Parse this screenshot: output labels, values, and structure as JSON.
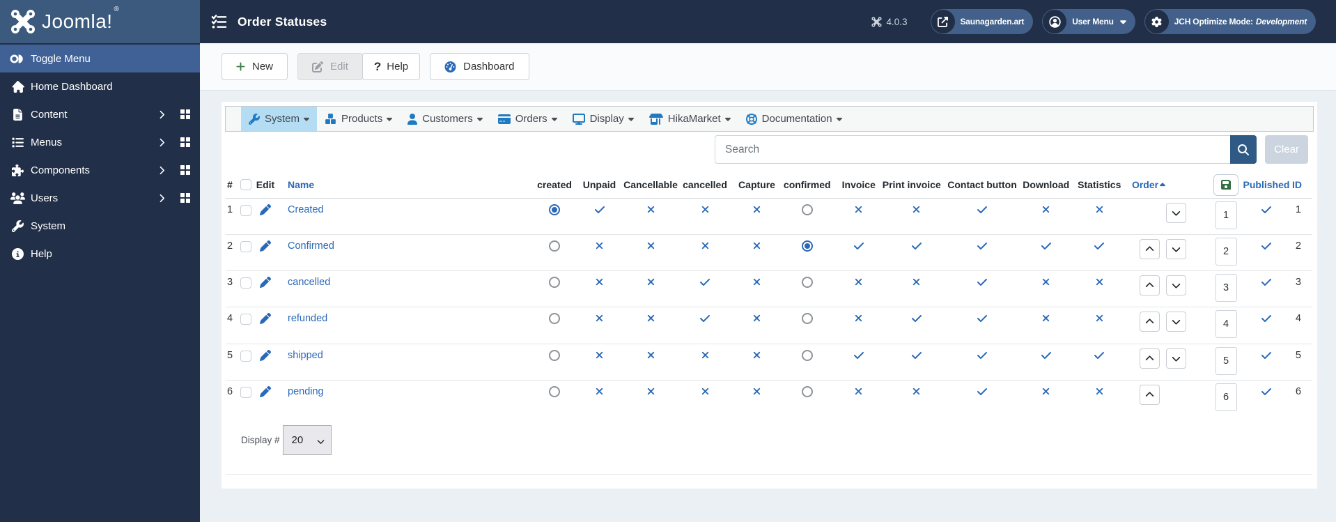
{
  "colors": {
    "topbar_bg": "#212f48",
    "brand_bg": "#3c5a7e",
    "sidebar_bg": "#212f48",
    "sidebar_active_bg": "#3f6195",
    "pill_bg": "#42608a",
    "page_bg": "#e9eef5",
    "link_blue": "#2a69b8",
    "menu_icon_blue": "#1f7ac2",
    "active_menu_bg": "#b4ddf3",
    "green_plus": "#3d7d46",
    "save_green": "#356e41",
    "search_btn_bg": "#2e5a85",
    "clear_btn_bg": "#ccd5df"
  },
  "topbar": {
    "brand_wordmark": "Joomla!",
    "brand_reg": "®",
    "page_title": "Order Statuses",
    "version": "4.0.3",
    "pills": [
      {
        "icon": "external-link-icon",
        "label": "Saunagarden.art",
        "caret": false
      },
      {
        "icon": "user-circle-icon",
        "label": "User Menu",
        "caret": true
      },
      {
        "icon": "gear-icon",
        "label": "JCH Optimize Mode:",
        "label_em": "Development",
        "caret": false
      }
    ]
  },
  "sidebar": {
    "items": [
      {
        "icon": "toggle-icon",
        "label": "Toggle Menu",
        "active": true,
        "chevron": false,
        "grid": false
      },
      {
        "icon": "home-icon",
        "label": "Home Dashboard",
        "active": false,
        "chevron": false,
        "grid": false
      },
      {
        "icon": "file-icon",
        "label": "Content",
        "active": false,
        "chevron": true,
        "grid": true
      },
      {
        "icon": "list-icon",
        "label": "Menus",
        "active": false,
        "chevron": true,
        "grid": true
      },
      {
        "icon": "puzzle-icon",
        "label": "Components",
        "active": false,
        "chevron": true,
        "grid": true
      },
      {
        "icon": "users-icon",
        "label": "Users",
        "active": false,
        "chevron": true,
        "grid": true
      },
      {
        "icon": "wrench-icon",
        "label": "System",
        "active": false,
        "chevron": false,
        "grid": false
      },
      {
        "icon": "info-circle-icon",
        "label": "Help",
        "active": false,
        "chevron": false,
        "grid": false
      }
    ]
  },
  "toolbar": {
    "buttons": [
      {
        "icon": "plus-icon",
        "icon_color": "#3d7d46",
        "label": "New",
        "disabled": false,
        "gap": "first"
      },
      {
        "icon": "edit-square-icon",
        "icon_color": "#9aa0a6",
        "label": "Edit",
        "disabled": true,
        "gap": "m14"
      },
      {
        "icon": "question",
        "icon_color": "#2b2f33",
        "label": "Help",
        "disabled": false,
        "gap": "m0"
      },
      {
        "icon": "gauge-icon",
        "icon_color": "#2a69b8",
        "label": "Dashboard",
        "disabled": false,
        "gap": "m14"
      }
    ]
  },
  "menubar": {
    "items": [
      {
        "icon": "wrench-icon",
        "label": "System",
        "active": true
      },
      {
        "icon": "cubes-icon",
        "label": "Products",
        "active": false
      },
      {
        "icon": "user-icon",
        "label": "Customers",
        "active": false
      },
      {
        "icon": "credit-card-icon",
        "label": "Orders",
        "active": false
      },
      {
        "icon": "display-icon",
        "label": "Display",
        "active": false
      },
      {
        "icon": "shop-icon",
        "label": "HikaMarket",
        "active": false
      },
      {
        "icon": "life-ring-icon",
        "label": "Documentation",
        "active": false
      }
    ]
  },
  "filter": {
    "search_placeholder": "Search",
    "search_value": "",
    "clear_label": "Clear"
  },
  "table": {
    "columns": {
      "num": "#",
      "edit": "Edit",
      "name": "Name",
      "flags": [
        "created",
        "Unpaid",
        "Cancellable",
        "cancelled",
        "Capture",
        "confirmed",
        "Invoice",
        "Print invoice",
        "Contact button",
        "Download",
        "Statistics"
      ],
      "order": "Order",
      "order_sort": "asc",
      "published": "Published",
      "id": "ID"
    },
    "rows": [
      {
        "num": "1",
        "name": "Created",
        "flags": [
          "radio-on",
          "check",
          "x",
          "x",
          "x",
          "radio-off",
          "x",
          "x",
          "check",
          "x",
          "x"
        ],
        "move_up": false,
        "move_down": true,
        "order_value": "1",
        "published": true,
        "id": "1"
      },
      {
        "num": "2",
        "name": "Confirmed",
        "flags": [
          "radio-off",
          "x",
          "x",
          "x",
          "x",
          "radio-on",
          "check",
          "check",
          "check",
          "check",
          "check"
        ],
        "move_up": true,
        "move_down": true,
        "order_value": "2",
        "published": true,
        "id": "2"
      },
      {
        "num": "3",
        "name": "cancelled",
        "flags": [
          "radio-off",
          "x",
          "x",
          "check",
          "x",
          "radio-off",
          "x",
          "x",
          "check",
          "x",
          "x"
        ],
        "move_up": true,
        "move_down": true,
        "order_value": "3",
        "published": true,
        "id": "3"
      },
      {
        "num": "4",
        "name": "refunded",
        "flags": [
          "radio-off",
          "x",
          "x",
          "check",
          "x",
          "radio-off",
          "x",
          "check",
          "check",
          "x",
          "x"
        ],
        "move_up": true,
        "move_down": true,
        "order_value": "4",
        "published": true,
        "id": "4"
      },
      {
        "num": "5",
        "name": "shipped",
        "flags": [
          "radio-off",
          "x",
          "x",
          "x",
          "x",
          "radio-off",
          "check",
          "check",
          "check",
          "check",
          "check"
        ],
        "move_up": true,
        "move_down": true,
        "order_value": "5",
        "published": true,
        "id": "5"
      },
      {
        "num": "6",
        "name": "pending",
        "flags": [
          "radio-off",
          "x",
          "x",
          "x",
          "x",
          "radio-off",
          "x",
          "x",
          "check",
          "x",
          "x"
        ],
        "move_up": true,
        "move_down": false,
        "order_value": "6",
        "published": true,
        "id": "6"
      }
    ]
  },
  "pagination": {
    "display_label": "Display #",
    "selected": "20"
  }
}
